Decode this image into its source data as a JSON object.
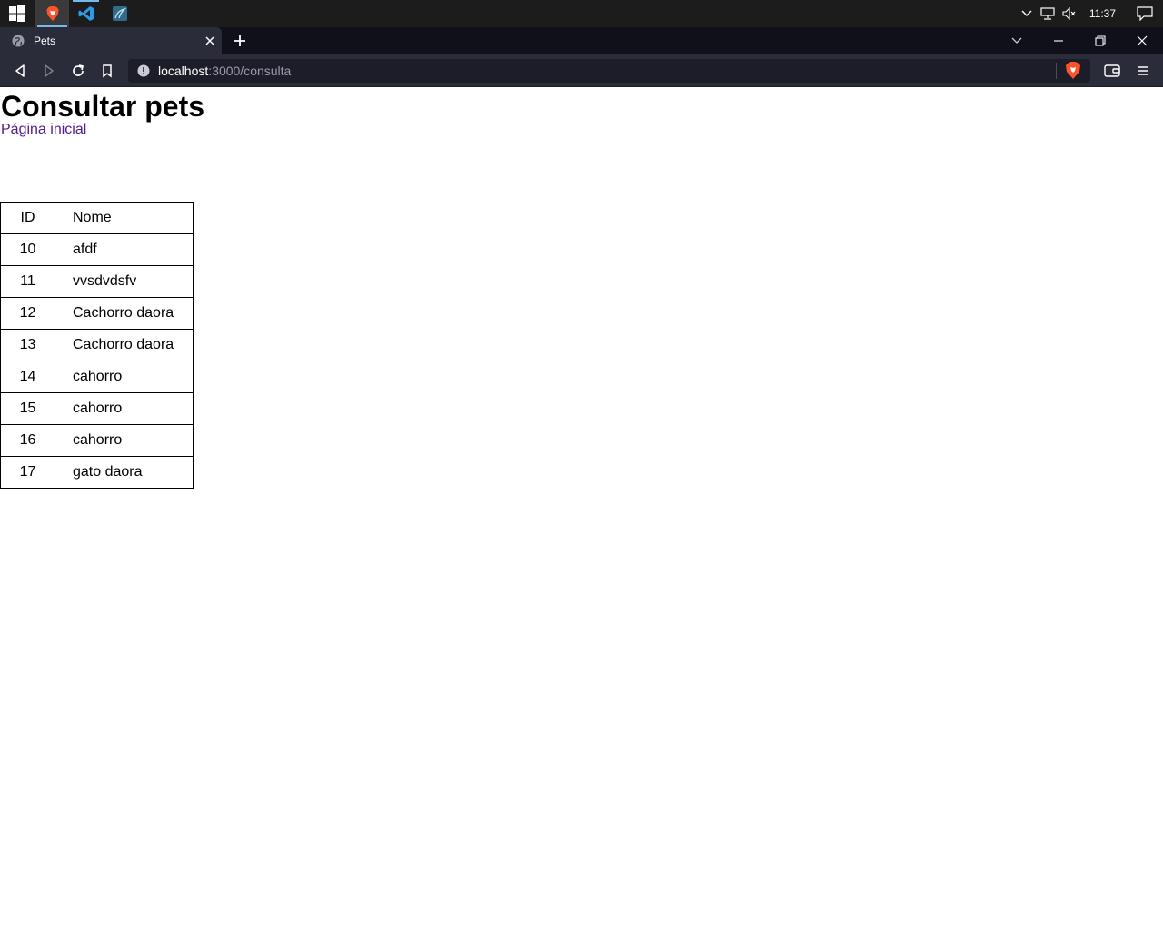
{
  "taskbar": {
    "apps": [
      {
        "name": "brave-browser-icon",
        "active": true
      },
      {
        "name": "vscode-icon",
        "active": false
      },
      {
        "name": "mysql-workbench-icon",
        "active": false
      }
    ],
    "clock": "11:37"
  },
  "browser": {
    "tab": {
      "title": "Pets"
    },
    "url": {
      "host": "localhost",
      "path": ":3000/consulta"
    }
  },
  "page": {
    "title": "Consultar pets",
    "home_link": "Página inicial",
    "table": {
      "headers": [
        "ID",
        "Nome"
      ],
      "rows": [
        [
          "10",
          "afdf"
        ],
        [
          "11",
          "vvsdvdsfv"
        ],
        [
          "12",
          "Cachorro daora"
        ],
        [
          "13",
          "Cachorro daora"
        ],
        [
          "14",
          "cahorro"
        ],
        [
          "15",
          "cahorro"
        ],
        [
          "16",
          "cahorro"
        ],
        [
          "17",
          "gato daora"
        ]
      ]
    }
  },
  "colors": {
    "taskbar": "#1c1c1c",
    "tabstrip": "#0f101a",
    "toolbar": "#2a2c3a",
    "visited_link": "#551a8b",
    "brave_orange": "#fb542b"
  }
}
